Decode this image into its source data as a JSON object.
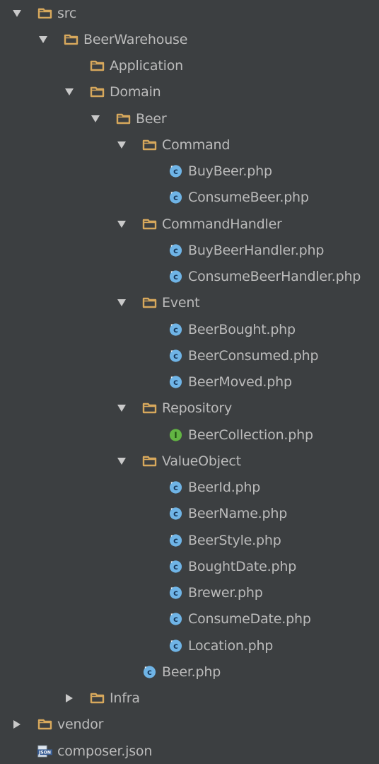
{
  "tree": {
    "nodes": [
      {
        "id": "src",
        "label": "src",
        "kind": "folder",
        "state": "expanded",
        "depth": 0
      },
      {
        "id": "beerwarehouse",
        "label": "BeerWarehouse",
        "kind": "folder",
        "state": "expanded",
        "depth": 1
      },
      {
        "id": "application",
        "label": "Application",
        "kind": "folder",
        "state": "leaf",
        "depth": 2
      },
      {
        "id": "domain",
        "label": "Domain",
        "kind": "folder",
        "state": "expanded",
        "depth": 2
      },
      {
        "id": "beer",
        "label": "Beer",
        "kind": "folder",
        "state": "expanded",
        "depth": 3
      },
      {
        "id": "command",
        "label": "Command",
        "kind": "folder",
        "state": "expanded",
        "depth": 4
      },
      {
        "id": "buybeer",
        "label": "BuyBeer.php",
        "kind": "class",
        "state": "leaf",
        "depth": 5
      },
      {
        "id": "consumebeer",
        "label": "ConsumeBeer.php",
        "kind": "class",
        "state": "leaf",
        "depth": 5
      },
      {
        "id": "commandhandler",
        "label": "CommandHandler",
        "kind": "folder",
        "state": "expanded",
        "depth": 4
      },
      {
        "id": "buybeerhandler",
        "label": "BuyBeerHandler.php",
        "kind": "class",
        "state": "leaf",
        "depth": 5
      },
      {
        "id": "consumebeerhandler",
        "label": "ConsumeBeerHandler.php",
        "kind": "class",
        "state": "leaf",
        "depth": 5
      },
      {
        "id": "event",
        "label": "Event",
        "kind": "folder",
        "state": "expanded",
        "depth": 4
      },
      {
        "id": "beerbought",
        "label": "BeerBought.php",
        "kind": "class",
        "state": "leaf",
        "depth": 5
      },
      {
        "id": "beerconsumed",
        "label": "BeerConsumed.php",
        "kind": "class",
        "state": "leaf",
        "depth": 5
      },
      {
        "id": "beermoved",
        "label": "BeerMoved.php",
        "kind": "class",
        "state": "leaf",
        "depth": 5
      },
      {
        "id": "repository",
        "label": "Repository",
        "kind": "folder",
        "state": "expanded",
        "depth": 4
      },
      {
        "id": "beercollection",
        "label": "BeerCollection.php",
        "kind": "interface",
        "state": "leaf",
        "depth": 5
      },
      {
        "id": "valueobject",
        "label": "ValueObject",
        "kind": "folder",
        "state": "expanded",
        "depth": 4
      },
      {
        "id": "beerid",
        "label": "BeerId.php",
        "kind": "class",
        "state": "leaf",
        "depth": 5
      },
      {
        "id": "beername",
        "label": "BeerName.php",
        "kind": "class",
        "state": "leaf",
        "depth": 5
      },
      {
        "id": "beerstyle",
        "label": "BeerStyle.php",
        "kind": "class",
        "state": "leaf",
        "depth": 5
      },
      {
        "id": "boughtdate",
        "label": "BoughtDate.php",
        "kind": "class",
        "state": "leaf",
        "depth": 5
      },
      {
        "id": "brewer",
        "label": "Brewer.php",
        "kind": "class",
        "state": "leaf",
        "depth": 5
      },
      {
        "id": "consumedate",
        "label": "ConsumeDate.php",
        "kind": "class",
        "state": "leaf",
        "depth": 5
      },
      {
        "id": "location",
        "label": "Location.php",
        "kind": "class",
        "state": "leaf",
        "depth": 5
      },
      {
        "id": "beerphp",
        "label": "Beer.php",
        "kind": "class",
        "state": "leaf",
        "depth": 4
      },
      {
        "id": "infra",
        "label": "Infra",
        "kind": "folder",
        "state": "collapsed",
        "depth": 2
      },
      {
        "id": "vendor",
        "label": "vendor",
        "kind": "folder",
        "state": "collapsed",
        "depth": 0
      },
      {
        "id": "composer",
        "label": "composer.json",
        "kind": "json",
        "state": "leaf",
        "depth": 0
      }
    ]
  },
  "icons": {
    "folder": "folder-icon",
    "class": "php-class-icon",
    "interface": "php-interface-icon",
    "json": "json-file-icon",
    "expanded": "chevron-down-icon",
    "collapsed": "chevron-right-icon",
    "json_badge": "JSON"
  },
  "colors": {
    "background": "#3c3f41",
    "text": "#bbbbbb",
    "arrow": "#c9c9c9",
    "folder_stroke": "#d7a85c",
    "class_fill": "#6fb4e6",
    "class_letter": "#17375a",
    "interface_fill": "#62b543",
    "interface_letter": "#1f4d12"
  }
}
